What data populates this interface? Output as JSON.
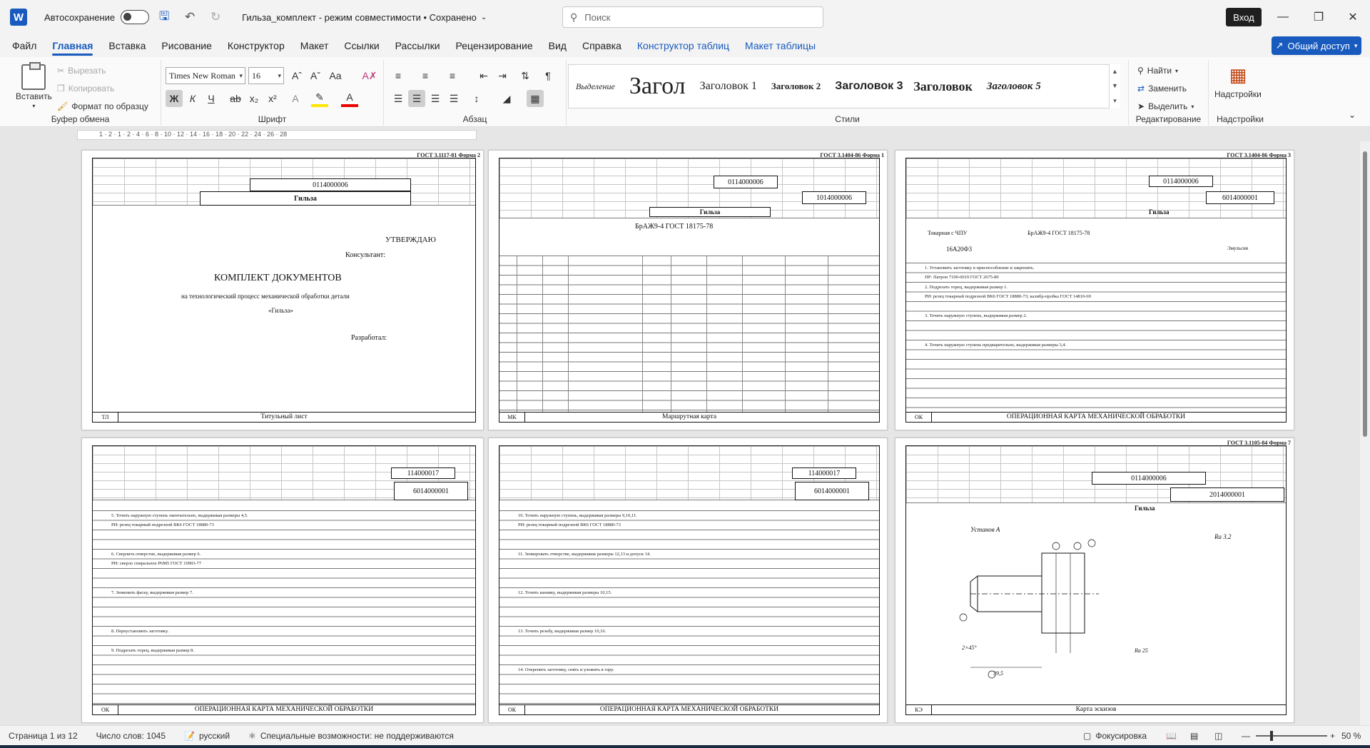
{
  "titlebar": {
    "autosave_label": "Автосохранение",
    "doc_title": "Гильза_комплект  -  режим совместимости  •  Сохранено",
    "search_placeholder": "Поиск",
    "signin_label": "Вход"
  },
  "tabs": [
    "Файл",
    "Главная",
    "Вставка",
    "Рисование",
    "Конструктор",
    "Макет",
    "Ссылки",
    "Рассылки",
    "Рецензирование",
    "Вид",
    "Справка",
    "Конструктор таблиц",
    "Макет таблицы"
  ],
  "share_label": "Общий доступ",
  "ribbon": {
    "clipboard": {
      "paste": "Вставить",
      "cut": "Вырезать",
      "copy": "Копировать",
      "format_painter": "Формат по образцу",
      "label": "Буфер обмена"
    },
    "font": {
      "name": "Times New Roman",
      "size": "16",
      "label": "Шрифт",
      "bold": "Ж",
      "italic": "К",
      "underline": "Ч"
    },
    "paragraph": {
      "label": "Абзац"
    },
    "styles": {
      "label": "Стили",
      "items": [
        "Выделение",
        "Загол",
        "Заголовок 1",
        "Заголовок 2",
        "Заголовок 3",
        "Заголовок",
        "Заголовок 5"
      ]
    },
    "editing": {
      "find": "Найти",
      "replace": "Заменить",
      "select": "Выделить",
      "label": "Редактирование"
    },
    "addins": {
      "button": "Надстройки",
      "label": "Надстройки"
    }
  },
  "pages": [
    {
      "form": "ГОСТ 3.1117-81      Форма 2",
      "code1": "0114000006",
      "title": "Гильза",
      "caption": "Титульный лист",
      "caption_left": "ТЛ",
      "approve": "УТВЕРЖДАЮ",
      "consultant": "Консультант:",
      "heading": "КОМПЛЕКТ ДОКУМЕНТОВ",
      "sub": "на технологический процесс механической обработки детали",
      "part": "«Гильза»",
      "developer": "Разработал:"
    },
    {
      "form": "ГОСТ 3.1404-86      Форма 1",
      "code1": "0114000006",
      "code2": "1014000006",
      "title": "Гильза",
      "material": "БрАЖ9-4 ГОСТ 18175-78",
      "caption": "Маршрутная карта",
      "caption_left": "МК"
    },
    {
      "form": "ГОСТ 3.1404-86      Форма 3",
      "code1": "0114000006",
      "code2": "6014000001",
      "title": "Гильза",
      "machine": "Токарная с ЧПУ",
      "material": "БрАЖ9-4 ГОСТ 18175-78",
      "model": "16А20Ф3",
      "coolant": "Эмульсия",
      "caption": "ОПЕРАЦИОННАЯ КАРТА МЕХАНИЧЕСКОЙ ОБРАБОТКИ",
      "caption_left": "ОК"
    },
    {
      "code1": "114000017",
      "code2": "6014000001",
      "caption": "ОПЕРАЦИОННАЯ КАРТА МЕХАНИЧЕСКОЙ ОБРАБОТКИ",
      "caption_left": "ОК"
    },
    {
      "code1": "114000017",
      "code2": "6014000001",
      "caption": "ОПЕРАЦИОННАЯ КАРТА МЕХАНИЧЕСКОЙ ОБРАБОТКИ",
      "caption_left": "ОК"
    },
    {
      "form": "ГОСТ 3.1105-84      Форма 7",
      "code1": "0114000006",
      "code2": "2014000001",
      "title": "Гильза",
      "setup": "Установ А",
      "roughness": "Ra 3.2",
      "roughness2": "Ra 25",
      "chamfer": "2×45°",
      "dim_len": "39,5",
      "caption": "Карта эскизов",
      "caption_left": "КЭ"
    }
  ],
  "ops_page3": [
    "1. Установить заготовку в приспособление и закрепить.",
    "ПР: Патрон 7100-0019 ГОСТ 2675-80",
    "2. Подрезать торец, выдерживая размер 1.",
    "РИ: резец токарный подрезной ВК6 ГОСТ 18880-73; калибр-пробка ГОСТ 14810-69",
    "3. Точить наружную ступень, выдерживая размер 2.",
    "4. Точить наружную ступень предварительно, выдерживая размеры 3,4."
  ],
  "ops_page4": [
    "5. Точить наружную ступень окончательно, выдерживая размеры 4,5.",
    "РИ: резец токарный подрезной ВК6 ГОСТ 18880-73",
    "6. Сверлить отверстие, выдерживая размер 6.",
    "РИ: сверло спиральное Р6М5 ГОСТ 10903-77",
    "7. Зенковать фаску, выдерживая размер 7.",
    "8. Переустановить заготовку.",
    "9. Подрезать торец, выдерживая размер 8."
  ],
  "ops_page5": [
    "10. Точить наружную ступень, выдерживая размеры 9,10,11.",
    "РИ: резец токарный подрезной ВК6 ГОСТ 18880-73",
    "11. Зенкеровать отверстие, выдерживая размеры 12,13 и допуск 14.",
    "12. Точить канавку, выдерживая размеры 10,15.",
    "13. Точить резьбу, выдерживая размер 10,16.",
    "14. Открепить заготовку, снять и уложить в тару."
  ],
  "status": {
    "page": "Страница 1 из 12",
    "words": "Число слов: 1045",
    "lang": "русский",
    "access": "Специальные возможности: не поддерживаются",
    "focus": "Фокусировка",
    "zoom": "50 %"
  }
}
